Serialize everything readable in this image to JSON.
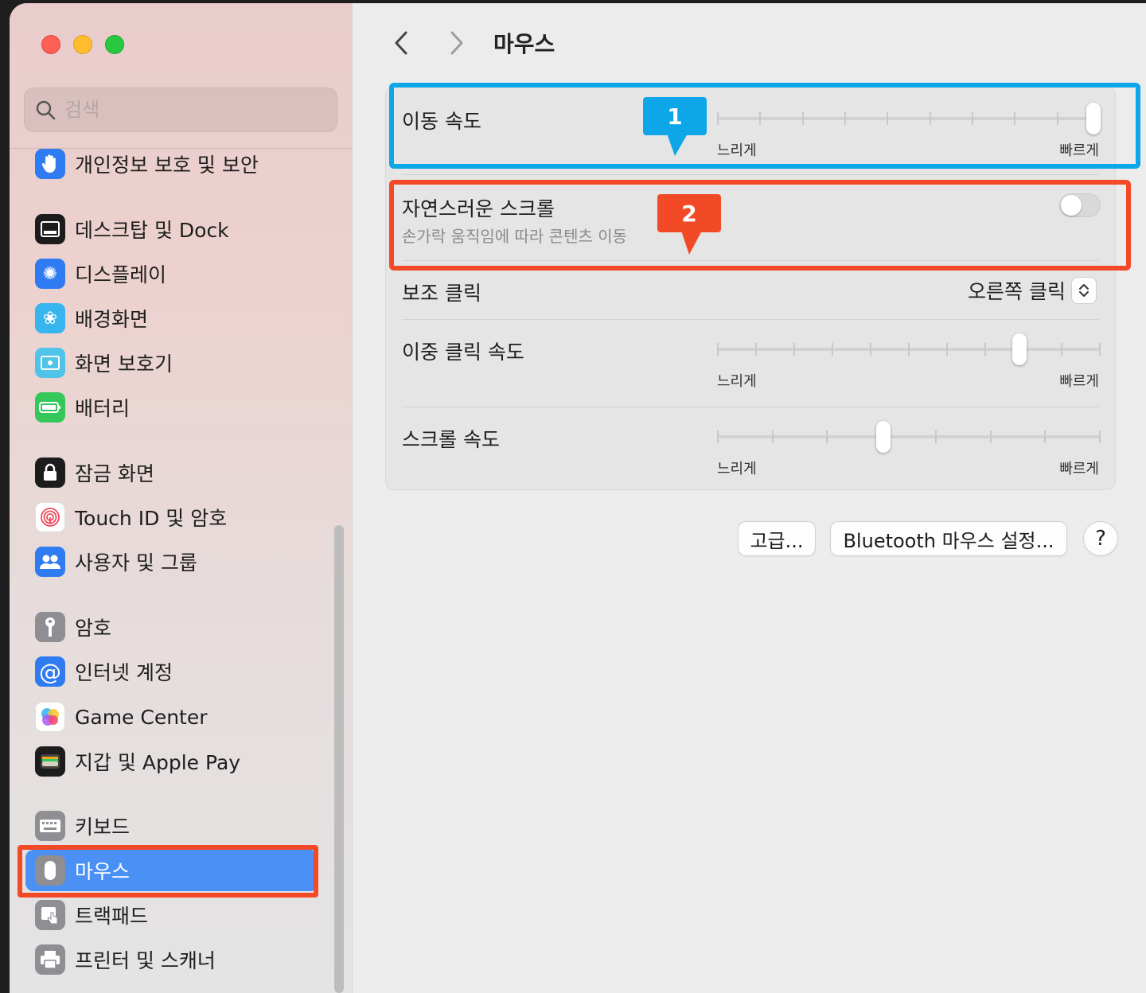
{
  "search": {
    "placeholder": "검색"
  },
  "sidebar": {
    "items": [
      {
        "label": "개인정보 보호 및 보안"
      },
      {
        "label": "데스크탑 및 Dock"
      },
      {
        "label": "디스플레이"
      },
      {
        "label": "배경화면"
      },
      {
        "label": "화면 보호기"
      },
      {
        "label": "배터리"
      },
      {
        "label": "잠금 화면"
      },
      {
        "label": "Touch ID 및 암호"
      },
      {
        "label": "사용자 및 그룹"
      },
      {
        "label": "암호"
      },
      {
        "label": "인터넷 계정"
      },
      {
        "label": "Game Center"
      },
      {
        "label": "지갑 및 Apple Pay"
      },
      {
        "label": "키보드"
      },
      {
        "label": "마우스"
      },
      {
        "label": "트랙패드"
      },
      {
        "label": "프린터 및 스캐너"
      }
    ],
    "selected": "마우스"
  },
  "header": {
    "back": "‹",
    "forward": "›",
    "title": "마우스"
  },
  "settings": {
    "tracking_speed": {
      "label": "이동 속도",
      "min_label": "느리게",
      "max_label": "빠르게",
      "value": 1.0,
      "ticks": 10
    },
    "natural_scroll": {
      "label": "자연스러운 스크롤",
      "description": "손가락 움직임에 따라 콘텐츠 이동",
      "enabled": false
    },
    "secondary_click": {
      "label": "보조 클릭",
      "value": "오른쪽 클릭"
    },
    "double_click_speed": {
      "label": "이중 클릭 속도",
      "min_label": "느리게",
      "max_label": "빠르게",
      "value": 0.8,
      "ticks": 11
    },
    "scroll_speed": {
      "label": "스크롤 속도",
      "min_label": "느리게",
      "max_label": "빠르게",
      "value": 0.43,
      "ticks": 8
    }
  },
  "buttons": {
    "advanced": "고급...",
    "bluetooth": "Bluetooth 마우스 설정...",
    "help": "?"
  },
  "annotations": [
    {
      "number": "1",
      "color": "#0da6e8"
    },
    {
      "number": "2",
      "color": "#f24a27"
    }
  ],
  "colors": {
    "accent": "#4a90f5",
    "highlight_red": "#f24a27",
    "highlight_blue": "#0da6e8"
  }
}
